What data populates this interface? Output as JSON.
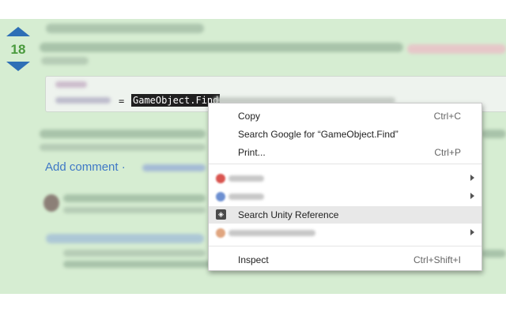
{
  "vote": {
    "score": "18"
  },
  "code": {
    "operator": "=",
    "selected": "GameObject.Find"
  },
  "comments": {
    "add_comment": "Add comment ·"
  },
  "context_menu": {
    "copy": {
      "label": "Copy",
      "shortcut": "Ctrl+C"
    },
    "search_google": {
      "label": "Search Google for “GameObject.Find”"
    },
    "print": {
      "label": "Print...",
      "shortcut": "Ctrl+P"
    },
    "search_unity": {
      "label": "Search Unity Reference"
    },
    "inspect": {
      "label": "Inspect",
      "shortcut": "Ctrl+Shift+I"
    }
  },
  "colors": {
    "background": "#d6edd2",
    "vote_arrow": "#2e6fb6",
    "score": "#4a9a3d",
    "link": "#3f78c6",
    "menu_highlight": "#e8e8e8"
  },
  "icons": [
    "arrow-up-icon",
    "arrow-down-icon",
    "unity-icon",
    "submenu-arrow-icon"
  ]
}
